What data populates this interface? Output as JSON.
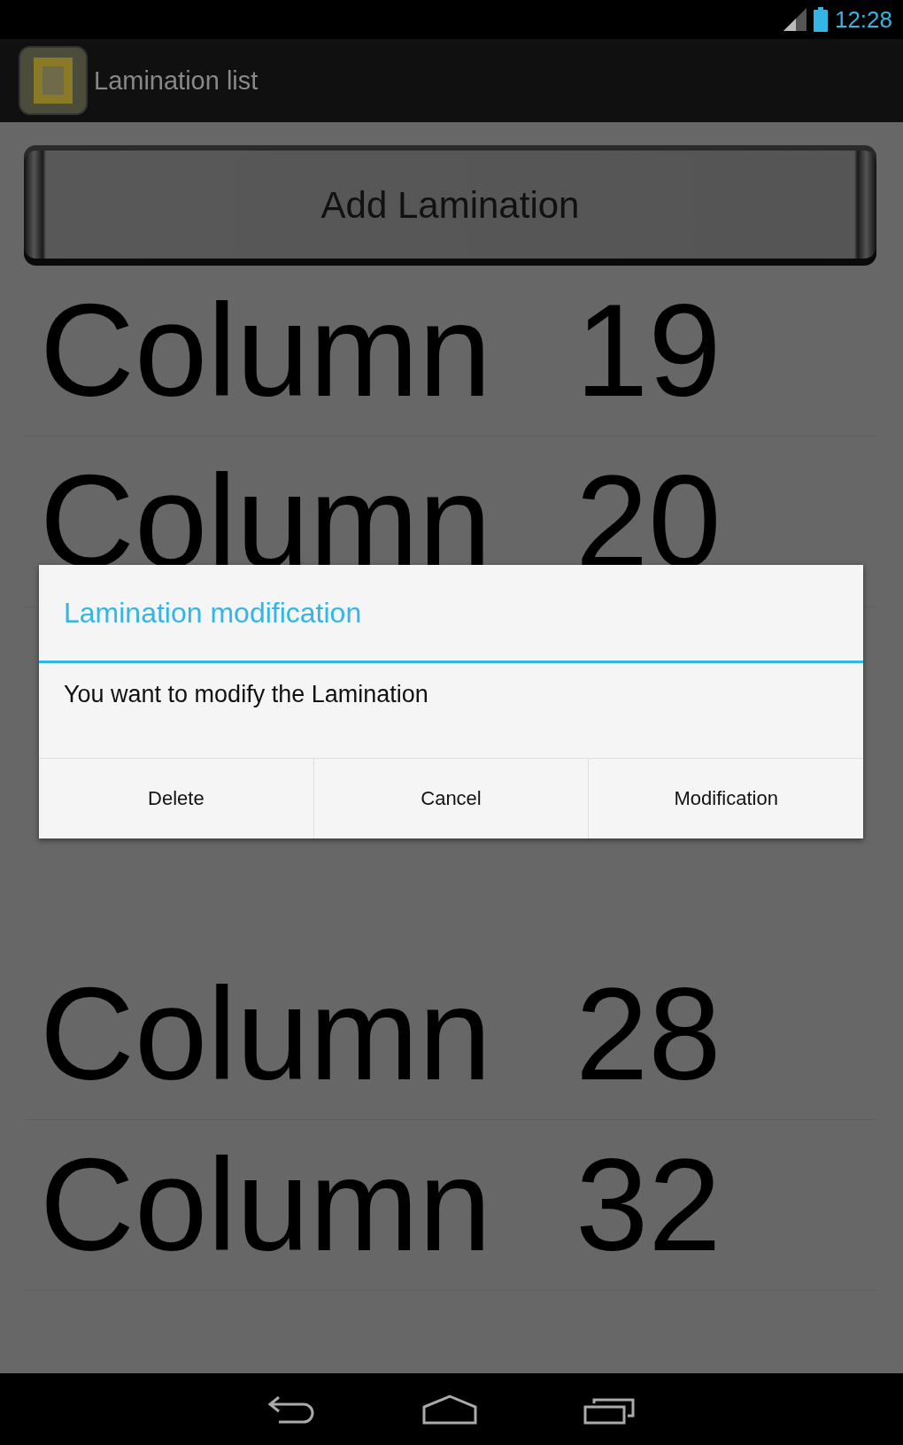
{
  "status_bar": {
    "time": "12:28"
  },
  "action_bar": {
    "title": "Lamination list"
  },
  "add_button": {
    "label": "Add Lamination"
  },
  "rows": [
    {
      "name": "Column",
      "number": "19"
    },
    {
      "name": "Column",
      "number": "20"
    },
    {
      "name": "Column",
      "number": "28"
    },
    {
      "name": "Column",
      "number": "32"
    }
  ],
  "dialog": {
    "title": "Lamination modification",
    "message": "You want to modify the Lamination",
    "buttons": [
      "Delete",
      "Cancel",
      "Modification"
    ]
  }
}
